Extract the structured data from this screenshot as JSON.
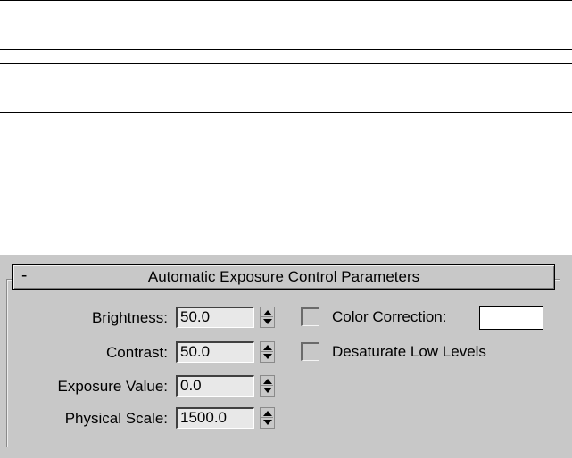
{
  "rollout": {
    "collapse_symbol": "-",
    "title": "Automatic Exposure Control Parameters"
  },
  "params": [
    {
      "label": "Brightness:",
      "value": "50.0"
    },
    {
      "label": "Contrast:",
      "value": "50.0"
    },
    {
      "label": "Exposure Value:",
      "value": "0.0"
    },
    {
      "label": "Physical Scale:",
      "value": "1500.0"
    }
  ],
  "options": {
    "color_correction": {
      "label": "Color Correction:",
      "checked": false,
      "swatch_color": "#ffffff"
    },
    "desaturate_low_levels": {
      "label": "Desaturate Low Levels",
      "checked": false
    }
  },
  "colors": {
    "panel_bg": "#c8c8c8",
    "field_bg": "#e8e8e8"
  },
  "icons": {
    "spinner": "spinner-arrows-icon",
    "collapse": "minus-icon"
  }
}
